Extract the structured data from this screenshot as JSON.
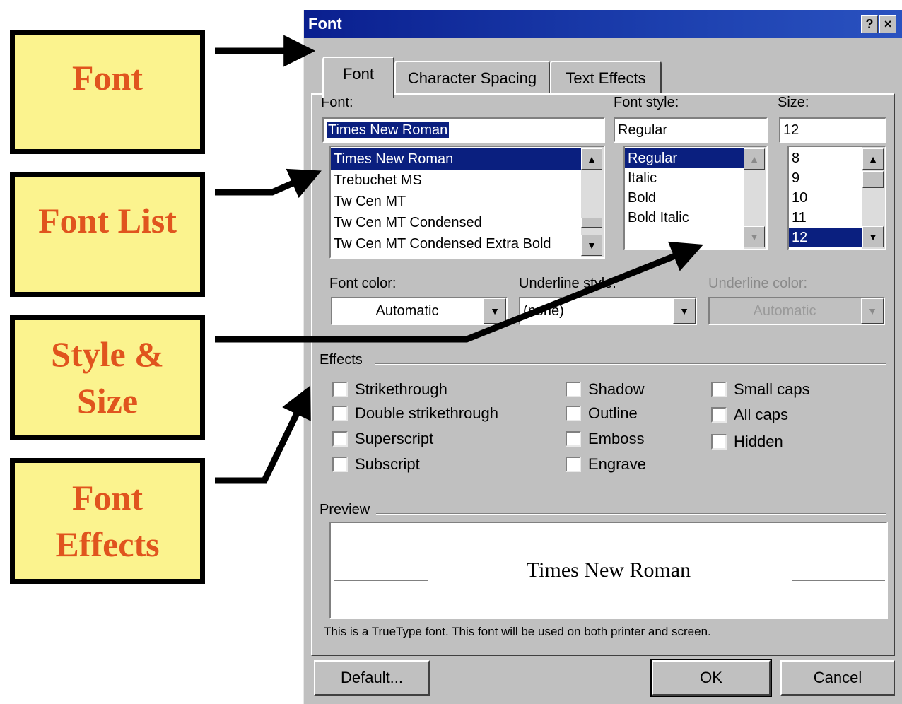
{
  "callouts": {
    "font": {
      "line1": "Font"
    },
    "font_list": {
      "line1": "Font List"
    },
    "style_size": {
      "line1": "Style &",
      "line2": "Size"
    },
    "font_effects": {
      "line1": "Font",
      "line2": "Effects"
    }
  },
  "dialog": {
    "title": "Font",
    "help_glyph": "?",
    "close_glyph": "×",
    "tabs": [
      {
        "label": "Font",
        "active": true
      },
      {
        "label": "Character Spacing",
        "active": false
      },
      {
        "label": "Text Effects",
        "active": false
      }
    ],
    "font": {
      "label": "Font:",
      "value": "Times New Roman",
      "list": [
        "Times New Roman",
        "Trebuchet MS",
        "Tw Cen MT",
        "Tw Cen MT Condensed",
        "Tw Cen MT Condensed Extra Bold"
      ],
      "selected": "Times New Roman"
    },
    "font_style": {
      "label": "Font style:",
      "value": "Regular",
      "list": [
        "Regular",
        "Italic",
        "Bold",
        "Bold Italic"
      ],
      "selected": "Regular"
    },
    "size": {
      "label": "Size:",
      "value": "12",
      "list": [
        "8",
        "9",
        "10",
        "11",
        "12"
      ],
      "selected": "12"
    },
    "font_color": {
      "label": "Font color:",
      "value": "Automatic"
    },
    "underline_style": {
      "label": "Underline style:",
      "value": "(none)"
    },
    "underline_color": {
      "label": "Underline color:",
      "value": "Automatic"
    },
    "effects": {
      "label": "Effects",
      "col1": [
        "Strikethrough",
        "Double strikethrough",
        "Superscript",
        "Subscript"
      ],
      "col2": [
        "Shadow",
        "Outline",
        "Emboss",
        "Engrave"
      ],
      "col3": [
        "Small caps",
        "All caps",
        "Hidden"
      ]
    },
    "preview": {
      "label": "Preview",
      "sample": "Times New Roman",
      "note": "This is a TrueType font. This font will be used on both printer and screen."
    },
    "buttons": {
      "default": "Default...",
      "ok": "OK",
      "cancel": "Cancel"
    }
  },
  "colors": {
    "callout_fill": "#fbf38e",
    "callout_text": "#e0541e",
    "title_bar": "#0a1f8f",
    "selection": "#0a1f7f",
    "dialog_face": "#c0c0c0"
  }
}
